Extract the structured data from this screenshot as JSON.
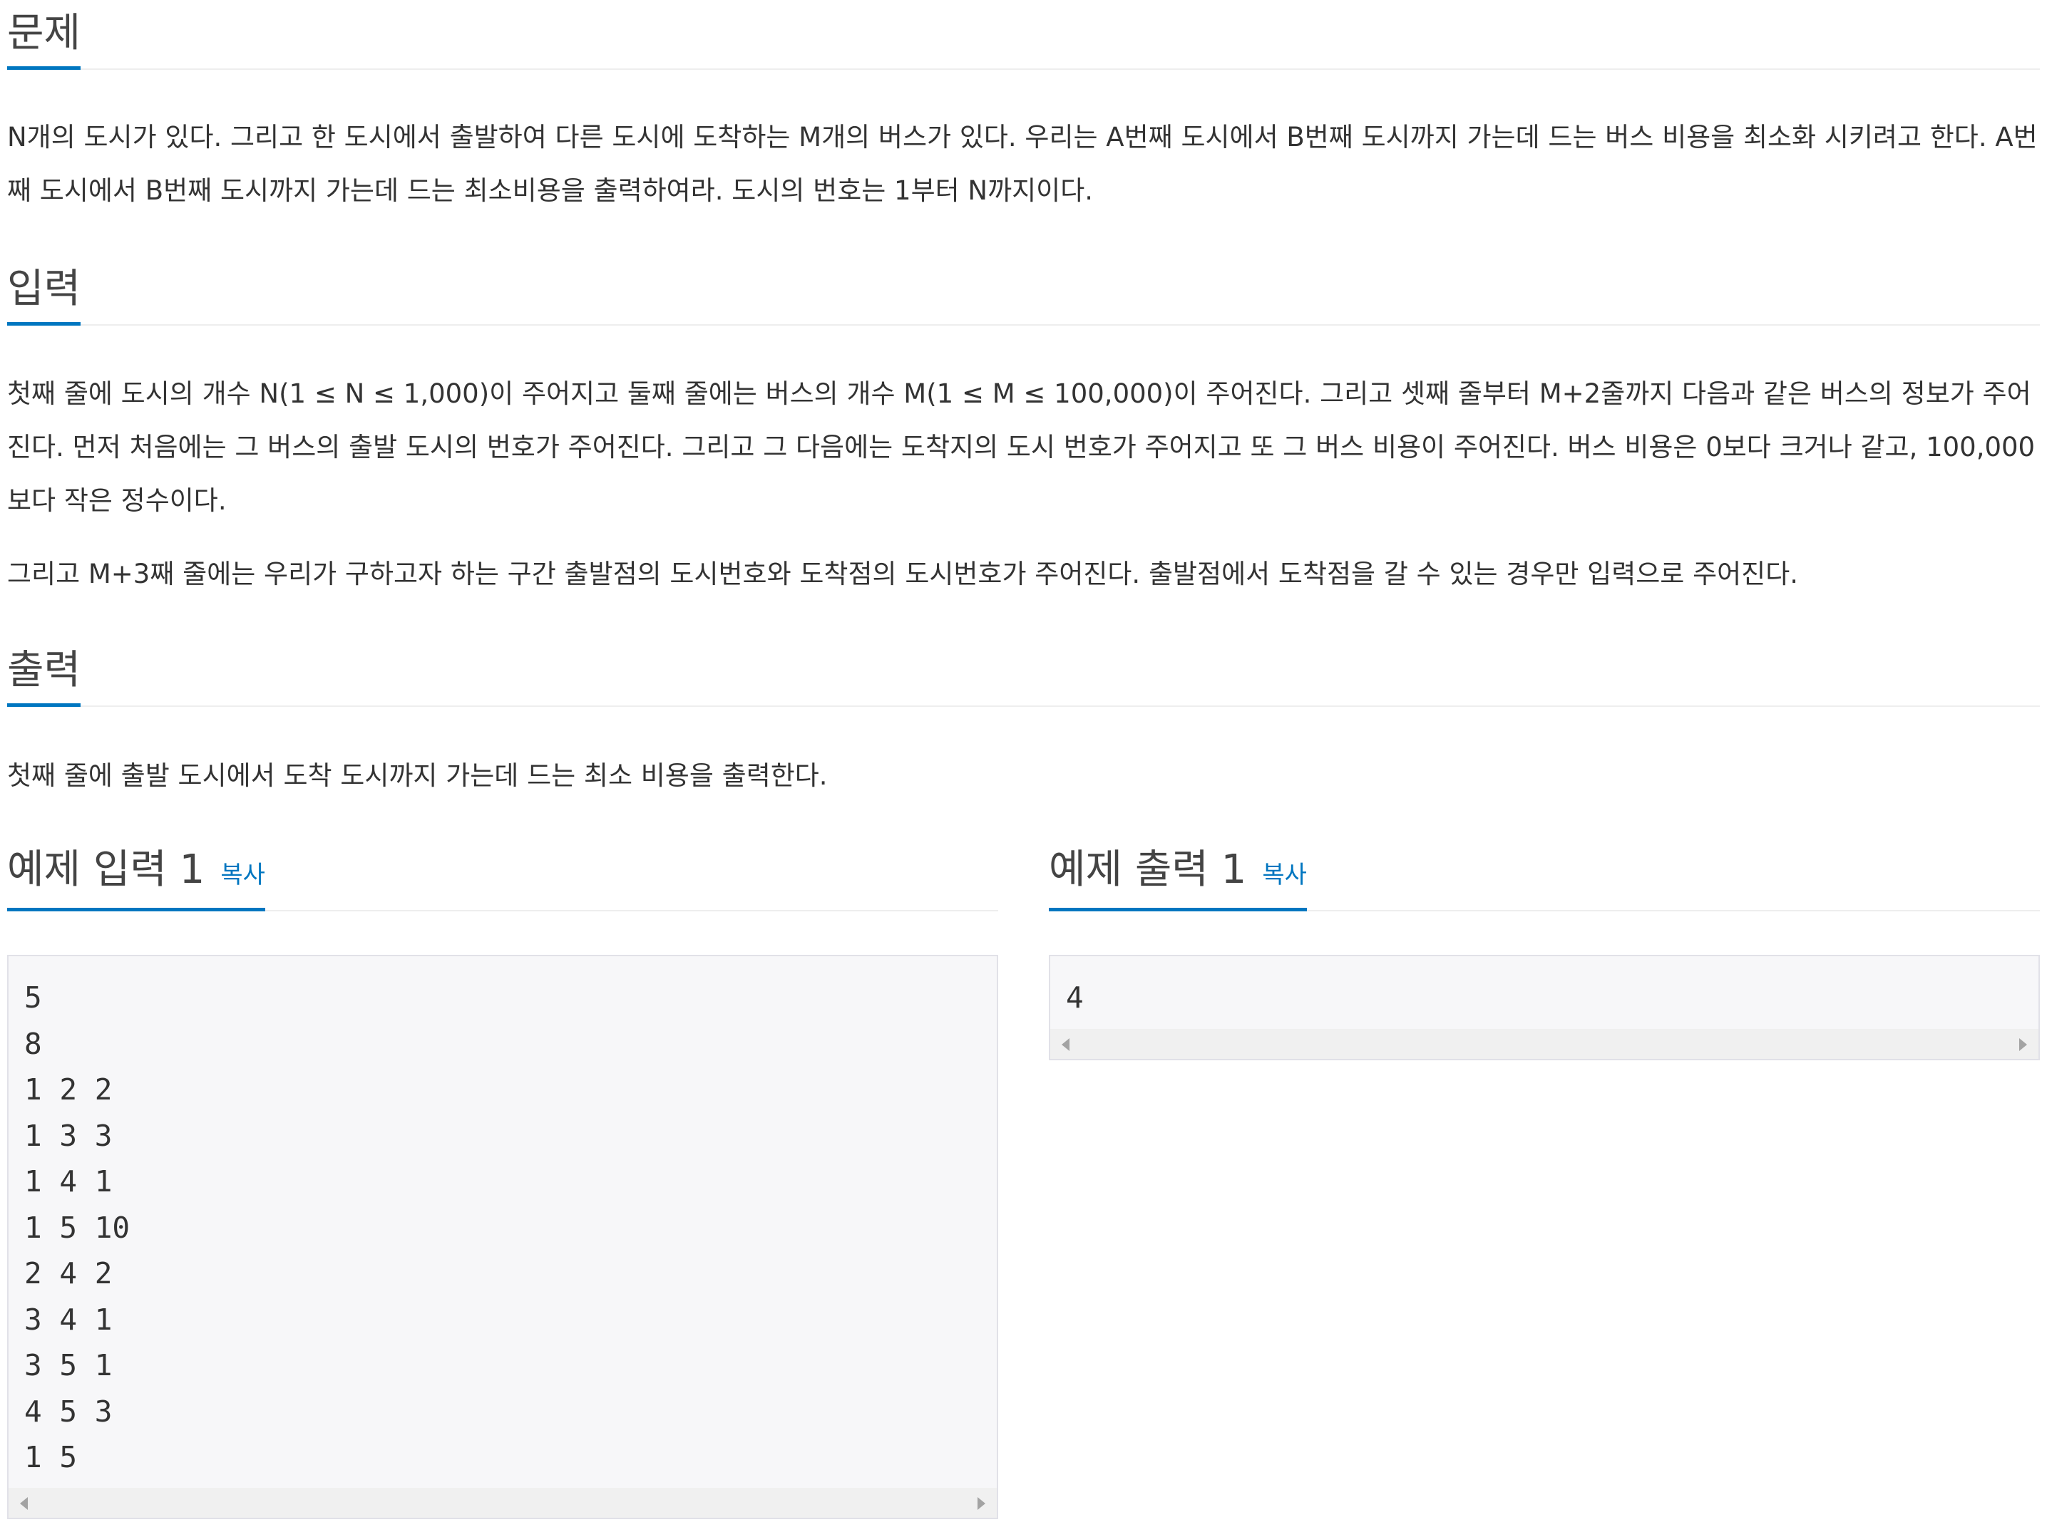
{
  "problem": {
    "heading": "문제",
    "text": "N개의 도시가 있다. 그리고 한 도시에서 출발하여 다른 도시에 도착하는 M개의 버스가 있다. 우리는 A번째 도시에서 B번째 도시까지 가는데 드는 버스 비용을 최소화 시키려고 한다. A번째 도시에서 B번째 도시까지 가는데 드는 최소비용을 출력하여라. 도시의 번호는 1부터 N까지이다."
  },
  "input": {
    "heading": "입력",
    "text1": "첫째 줄에 도시의 개수 N(1 ≤ N ≤ 1,000)이 주어지고 둘째 줄에는 버스의 개수 M(1 ≤ M ≤ 100,000)이 주어진다. 그리고 셋째 줄부터 M+2줄까지 다음과 같은 버스의 정보가 주어진다. 먼저 처음에는 그 버스의 출발 도시의 번호가 주어진다. 그리고 그 다음에는 도착지의 도시 번호가 주어지고 또 그 버스 비용이 주어진다. 버스 비용은 0보다 크거나 같고, 100,000보다 작은 정수이다.",
    "text2": "그리고 M+3째 줄에는 우리가 구하고자 하는 구간 출발점의 도시번호와 도착점의 도시번호가 주어진다. 출발점에서 도착점을 갈 수 있는 경우만 입력으로 주어진다."
  },
  "output": {
    "heading": "출력",
    "text": "첫째 줄에 출발 도시에서 도착 도시까지 가는데 드는 최소 비용을 출력한다."
  },
  "sample_input": {
    "heading": "예제 입력 1",
    "copy_label": "복사",
    "content": "5\n8\n1 2 2\n1 3 3\n1 4 1\n1 5 10\n2 4 2\n3 4 1\n3 5 1\n4 5 3\n1 5"
  },
  "sample_output": {
    "heading": "예제 출력 1",
    "copy_label": "복사",
    "content": "4"
  }
}
